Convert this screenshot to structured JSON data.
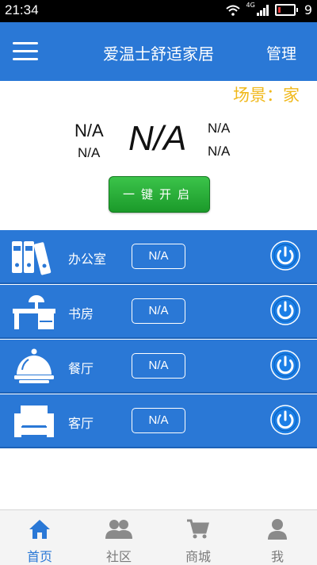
{
  "status_bar": {
    "time": "21:34",
    "network": "4G",
    "battery_level": "9"
  },
  "header": {
    "title": "爱温士舒适家居",
    "manage_label": "管理"
  },
  "scene": {
    "label": "场景：家"
  },
  "readouts": {
    "left_top": "N/A",
    "left_bottom": "N/A",
    "center": "N/A",
    "right_top": "N/A",
    "right_bottom": "N/A"
  },
  "one_key_button": {
    "label": "一键开启"
  },
  "rooms": [
    {
      "name": "办公室",
      "value": "N/A",
      "icon": "binders-icon"
    },
    {
      "name": "书房",
      "value": "N/A",
      "icon": "desk-lamp-icon"
    },
    {
      "name": "餐厅",
      "value": "N/A",
      "icon": "dish-cover-icon"
    },
    {
      "name": "客厅",
      "value": "N/A",
      "icon": "sofa-icon"
    }
  ],
  "bottom_nav": [
    {
      "label": "首页",
      "icon": "home-icon",
      "active": true
    },
    {
      "label": "社区",
      "icon": "people-icon",
      "active": false
    },
    {
      "label": "商城",
      "icon": "cart-icon",
      "active": false
    },
    {
      "label": "我",
      "icon": "user-icon",
      "active": false
    }
  ],
  "colors": {
    "primary": "#2a78d6",
    "accent_yellow": "#f0b81a",
    "button_green": "#2aac38",
    "power_blue": "#1c7fe6"
  }
}
